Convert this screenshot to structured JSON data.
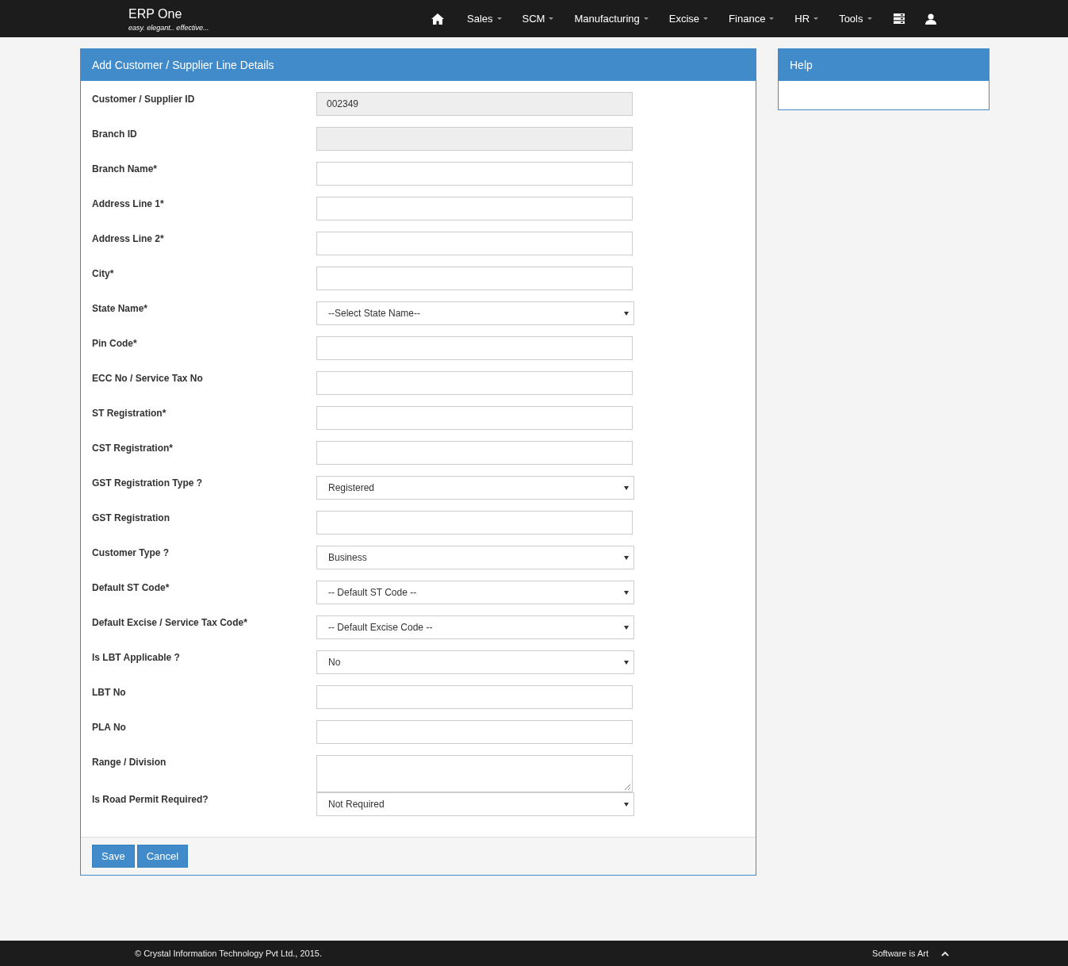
{
  "brand": {
    "title": "ERP One",
    "tagline": "easy. elegant.. effective..."
  },
  "nav": [
    {
      "label": "Sales"
    },
    {
      "label": "SCM"
    },
    {
      "label": "Manufacturing"
    },
    {
      "label": "Excise"
    },
    {
      "label": "Finance"
    },
    {
      "label": "HR"
    },
    {
      "label": "Tools"
    }
  ],
  "form": {
    "title": "Add Customer / Supplier Line Details",
    "fields": [
      {
        "label": "Customer / Supplier ID",
        "kind": "readonly",
        "value": "002349"
      },
      {
        "label": "Branch ID",
        "kind": "readonly"
      },
      {
        "label": "Branch Name*",
        "kind": "text"
      },
      {
        "label": "Address Line 1*",
        "kind": "text"
      },
      {
        "label": "Address Line 2*",
        "kind": "text"
      },
      {
        "label": "City*",
        "kind": "text"
      },
      {
        "label": "State Name*",
        "kind": "select",
        "value": "--Select State Name--"
      },
      {
        "label": "Pin Code*",
        "kind": "text"
      },
      {
        "label": "ECC No / Service Tax No",
        "kind": "text"
      },
      {
        "label": "ST Registration*",
        "kind": "text"
      },
      {
        "label": "CST Registration*",
        "kind": "text"
      },
      {
        "label": "GST Registration Type ?",
        "kind": "select",
        "value": "Registered"
      },
      {
        "label": "GST Registration",
        "kind": "text"
      },
      {
        "label": "Customer Type ?",
        "kind": "select",
        "value": "Business"
      },
      {
        "label": "Default ST Code*",
        "kind": "select",
        "value": "-- Default ST Code --"
      },
      {
        "label": "Default Excise / Service Tax Code*",
        "kind": "select",
        "value": "-- Default Excise Code --"
      },
      {
        "label": "Is LBT Applicable ?",
        "kind": "select",
        "value": "No"
      },
      {
        "label": "LBT No",
        "kind": "text"
      },
      {
        "label": "PLA No",
        "kind": "text"
      },
      {
        "label": "Range / Division",
        "kind": "textarea"
      },
      {
        "label": "Is Road Permit Required?",
        "kind": "select",
        "value": "Not Required"
      }
    ],
    "buttons": [
      "Save",
      "Cancel"
    ]
  },
  "help": {
    "title": "Help"
  },
  "footer": {
    "copyright": "© Crystal Information Technology Pvt Ltd., 2015.",
    "motto": "Software is Art"
  }
}
